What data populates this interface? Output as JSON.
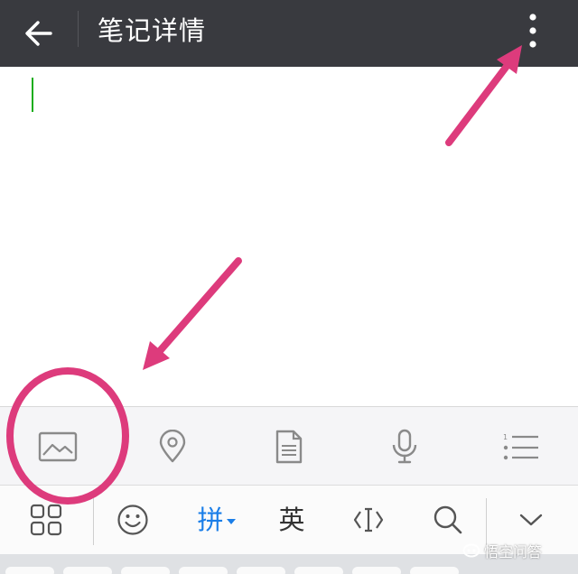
{
  "header": {
    "title": "笔记详情",
    "back_icon": "arrow-left-icon",
    "more_icon": "more-vertical-icon"
  },
  "editor": {
    "content": "",
    "cursor_color": "#1aad19"
  },
  "attach_bar": {
    "items": [
      "image-icon",
      "location-pin-icon",
      "document-icon",
      "microphone-icon",
      "list-icon"
    ]
  },
  "keyboard": {
    "toolbar": {
      "menu_icon": "grid-icon",
      "emoji_icon": "smiley-icon",
      "pinyin_label": "拼",
      "english_label": "英",
      "cursor_icon": "text-cursor-icon",
      "search_icon": "search-icon",
      "collapse_icon": "chevron-down-icon"
    }
  },
  "watermark": {
    "text": "悟空问答"
  },
  "colors": {
    "header_bg": "#393a3f",
    "annotation": "#dd3b7c",
    "active_ime": "#1a7ee8"
  }
}
